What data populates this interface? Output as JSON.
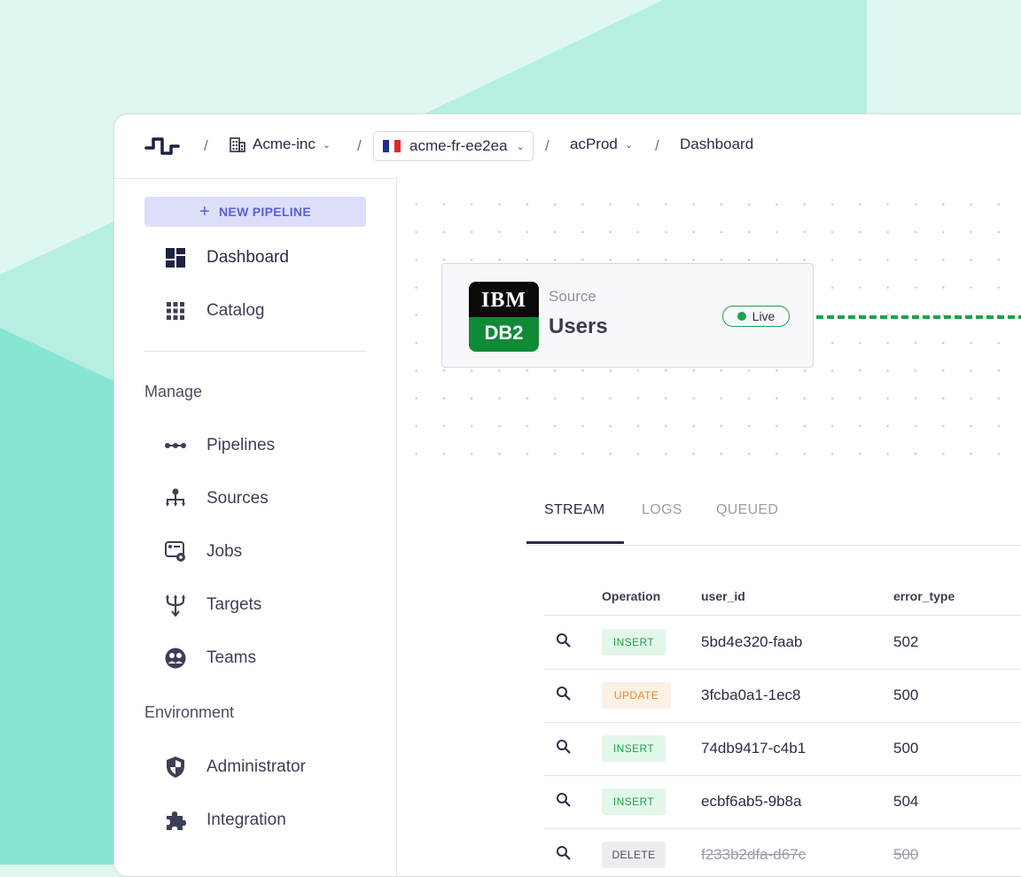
{
  "colors": {
    "accent": "#5a61d8",
    "accent_bg": "#dcdefa",
    "live": "#19a34a",
    "bg_mint": "#dff7f2",
    "bg_teal": "#87e6d2"
  },
  "breadcrumb": {
    "logo_icon": "pipeline-logo-icon",
    "org": {
      "label": "Acme-inc",
      "icon": "building-icon"
    },
    "region": {
      "label": "acme-fr-ee2ea",
      "icon": "france-flag-icon"
    },
    "project": {
      "label": "acProd"
    },
    "page": {
      "label": "Dashboard"
    }
  },
  "sidebar": {
    "new_pipeline_label": "NEW PIPELINE",
    "primary": [
      {
        "label": "Dashboard",
        "icon": "dashboard-icon"
      },
      {
        "label": "Catalog",
        "icon": "grid-icon"
      }
    ],
    "manage_title": "Manage",
    "manage": [
      {
        "label": "Pipelines",
        "icon": "pipeline-icon"
      },
      {
        "label": "Sources",
        "icon": "sitemap-icon"
      },
      {
        "label": "Jobs",
        "icon": "jobs-icon"
      },
      {
        "label": "Targets",
        "icon": "fork-icon"
      },
      {
        "label": "Teams",
        "icon": "teams-icon"
      }
    ],
    "environment_title": "Environment",
    "environment": [
      {
        "label": "Administrator",
        "icon": "shield-icon"
      },
      {
        "label": "Integration",
        "icon": "puzzle-icon"
      }
    ]
  },
  "node": {
    "kind": "Source",
    "title": "Users",
    "logo_top": "IBM",
    "logo_bottom": "DB2",
    "status": "Live"
  },
  "tabs": [
    {
      "label": "STREAM",
      "active": true
    },
    {
      "label": "LOGS",
      "active": false
    },
    {
      "label": "QUEUED",
      "active": false
    }
  ],
  "table": {
    "headers": [
      "Operation",
      "user_id",
      "error_type"
    ],
    "rows": [
      {
        "operation": "INSERT",
        "user_id": "5bd4e320-faab",
        "error_type": "502"
      },
      {
        "operation": "UPDATE",
        "user_id": "3fcba0a1-1ec8",
        "error_type": "500"
      },
      {
        "operation": "INSERT",
        "user_id": "74db9417-c4b1",
        "error_type": "500"
      },
      {
        "operation": "INSERT",
        "user_id": "ecbf6ab5-9b8a",
        "error_type": "504"
      },
      {
        "operation": "DELETE",
        "user_id": "f233b2dfa-d67c",
        "error_type": "500"
      }
    ]
  }
}
